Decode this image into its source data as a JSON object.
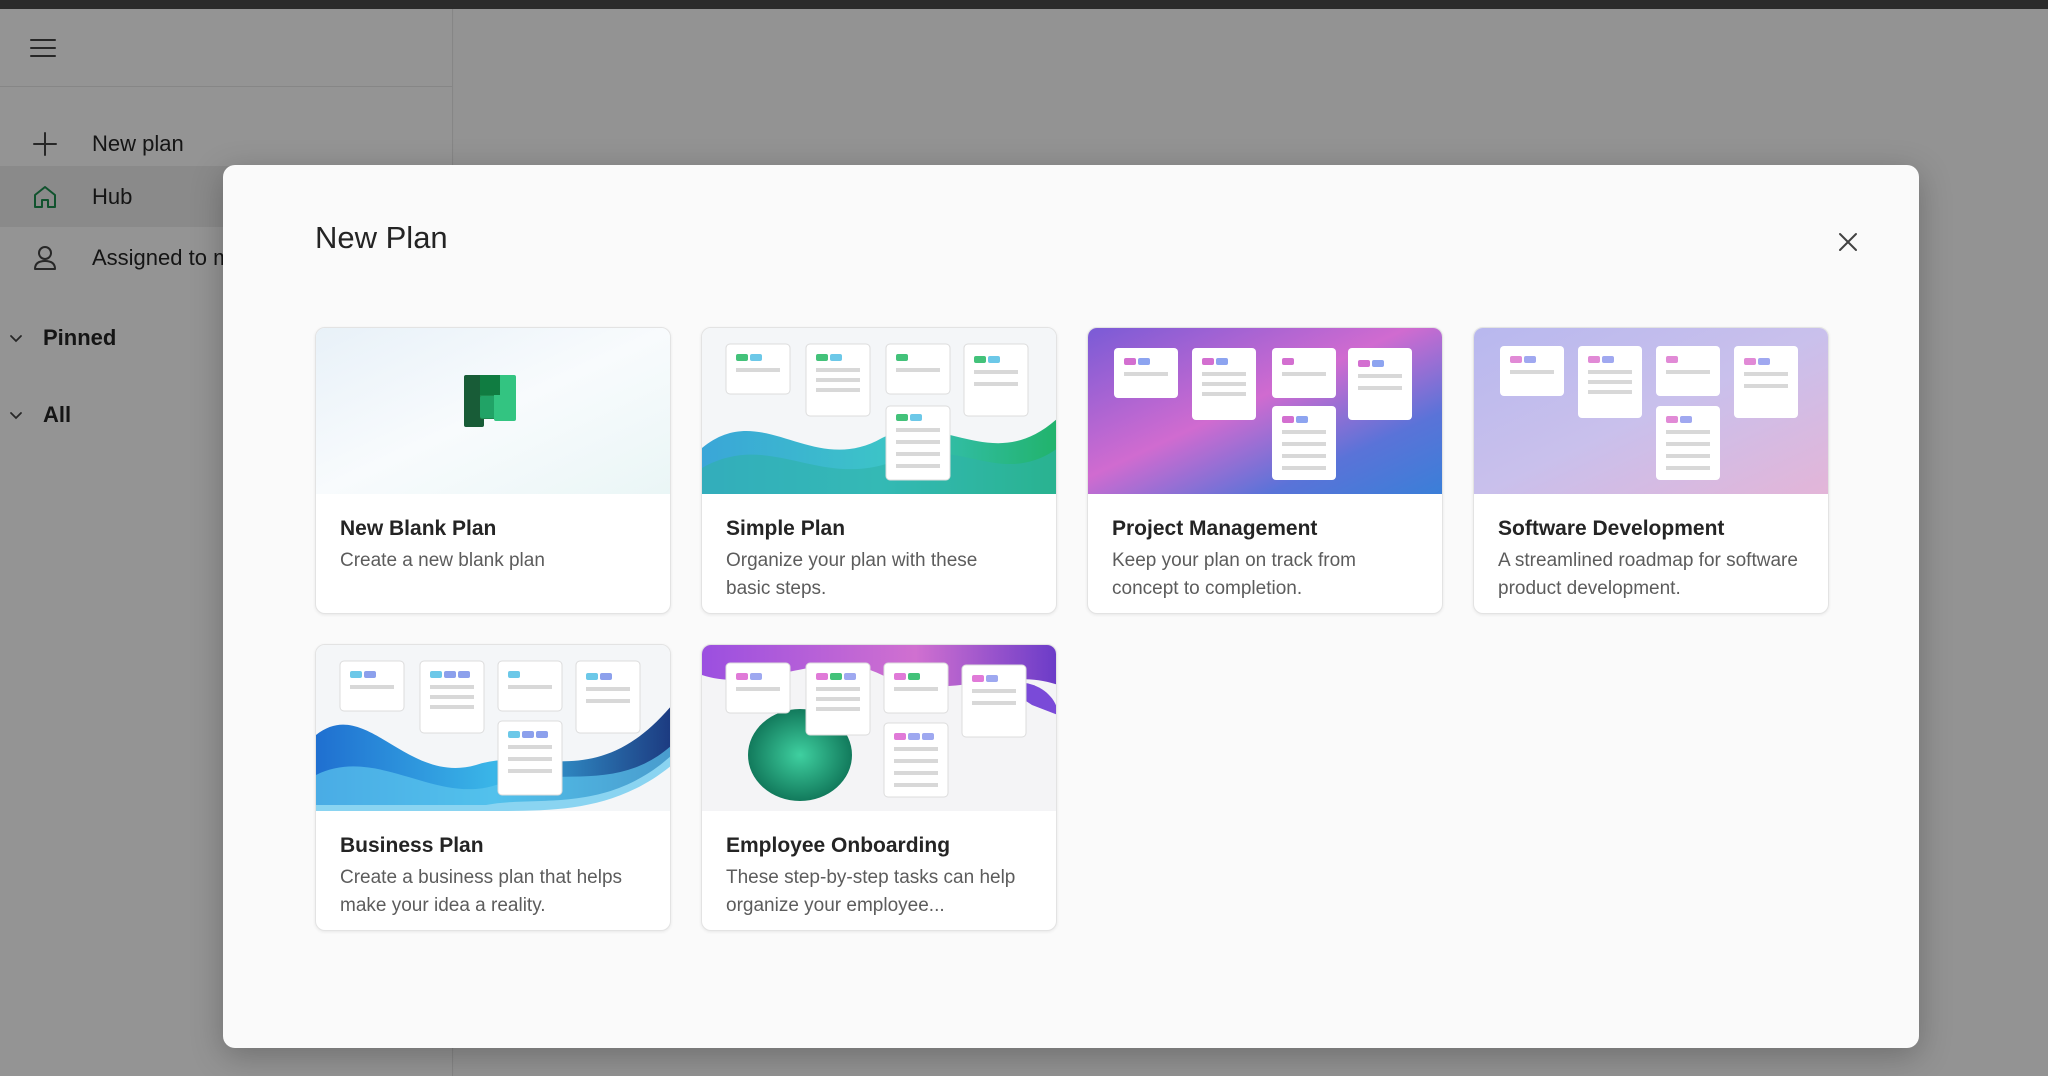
{
  "sidebar": {
    "items": [
      {
        "label": "New plan",
        "icon": "plus-icon"
      },
      {
        "label": "Hub",
        "icon": "home-icon"
      },
      {
        "label": "Assigned to me",
        "icon": "person-icon"
      }
    ],
    "sections": [
      {
        "label": "Pinned"
      },
      {
        "label": "All"
      }
    ]
  },
  "dialog": {
    "title": "New Plan",
    "close_icon": "close-icon",
    "templates": [
      {
        "title": "New Blank Plan",
        "description": "Create a new blank plan"
      },
      {
        "title": "Simple Plan",
        "description": "Organize your plan with these basic steps."
      },
      {
        "title": "Project Management",
        "description": "Keep your plan on track from concept to completion."
      },
      {
        "title": "Software Development",
        "description": "A streamlined roadmap for software product development."
      },
      {
        "title": "Business Plan",
        "description": "Create a business plan that helps make your idea a reality."
      },
      {
        "title": "Employee Onboarding",
        "description": "These step-by-step tasks can help organize your employee..."
      }
    ]
  },
  "colors": {
    "planner_green": "#1d8a4e",
    "overlay": "rgba(0,0,0,0.4)"
  }
}
